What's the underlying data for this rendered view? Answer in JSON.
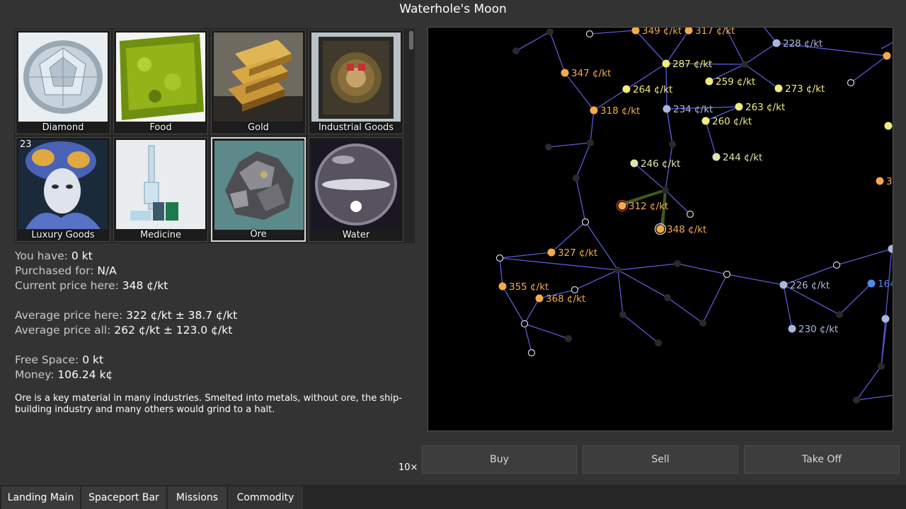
{
  "window": {
    "title": "Waterhole's Moon"
  },
  "commodities": [
    {
      "label": "Diamond",
      "qty": "",
      "icon": "diamond-icon"
    },
    {
      "label": "Food",
      "qty": "",
      "icon": "food-icon"
    },
    {
      "label": "Gold",
      "qty": "",
      "icon": "gold-icon"
    },
    {
      "label": "Industrial Goods",
      "qty": "",
      "icon": "industrial-goods-icon"
    },
    {
      "label": "Luxury Goods",
      "qty": "23",
      "icon": "luxury-goods-icon"
    },
    {
      "label": "Medicine",
      "qty": "",
      "icon": "medicine-icon"
    },
    {
      "label": "Ore",
      "qty": "",
      "icon": "ore-icon",
      "selected": true
    },
    {
      "label": "Water",
      "qty": "",
      "icon": "water-icon"
    }
  ],
  "info": {
    "you_have_label": "You have:",
    "you_have": "0 kt",
    "purchased_label": "Purchased for:",
    "purchased": "N/A",
    "current_label": "Current price here:",
    "current": "348 ¢/kt",
    "avg_here_label": "Average price here:",
    "avg_here": "322 ¢/kt ± 38.7 ¢/kt",
    "avg_all_label": "Average price all:",
    "avg_all": "262 ¢/kt ± 123.0 ¢/kt",
    "free_space_label": "Free Space:",
    "free_space": "0 kt",
    "money_label": "Money:",
    "money": "106.24 k¢"
  },
  "description": "Ore is a key material in many industries. Smelted into metals, without ore, the ship-building industry and many others would grind to a halt.",
  "map": {
    "colors": {
      "line": "#5a5ad8",
      "dark": "#2a2a2a",
      "orange": "#f4aa4a",
      "yellow": "#f2ec7a",
      "pale": "#dde6b0",
      "blue": "#a8b8dd",
      "bright_blue": "#4e8aea"
    },
    "price_labels": [
      {
        "text": "349 ¢/kt",
        "color": "orange"
      },
      {
        "text": "317 ¢/kt",
        "color": "orange"
      },
      {
        "text": "228 ¢/kt",
        "color": "blue"
      },
      {
        "text": "347 ¢/kt",
        "color": "orange"
      },
      {
        "text": "287 ¢/kt",
        "color": "yellow"
      },
      {
        "text": "259 ¢/kt",
        "color": "yellow"
      },
      {
        "text": "273 ¢/kt",
        "color": "yellow"
      },
      {
        "text": "264 ¢/kt",
        "color": "yellow"
      },
      {
        "text": "318 ¢/kt",
        "color": "orange"
      },
      {
        "text": "234 ¢/kt",
        "color": "blue"
      },
      {
        "text": "263 ¢/kt",
        "color": "yellow"
      },
      {
        "text": "260 ¢/kt",
        "color": "yellow"
      },
      {
        "text": "244 ¢/kt",
        "color": "pale"
      },
      {
        "text": "246 ¢/kt",
        "color": "pale"
      },
      {
        "text": "312 ¢/kt",
        "color": "orange"
      },
      {
        "text": "348 ¢/kt",
        "color": "orange"
      },
      {
        "text": "327 ¢/kt",
        "color": "orange"
      },
      {
        "text": "355 ¢/kt",
        "color": "orange"
      },
      {
        "text": "368 ¢/kt",
        "color": "orange"
      },
      {
        "text": "226 ¢/kt",
        "color": "blue"
      },
      {
        "text": "164",
        "color": "bright_blue"
      },
      {
        "text": "230 ¢/kt",
        "color": "blue"
      },
      {
        "text": "3",
        "color": "orange"
      }
    ]
  },
  "actions": {
    "multiplier": "10×",
    "buy": "Buy",
    "sell": "Sell",
    "takeoff": "Take Off"
  },
  "tabs": [
    "Landing Main",
    "Spaceport Bar",
    "Missions",
    "Commodity"
  ]
}
